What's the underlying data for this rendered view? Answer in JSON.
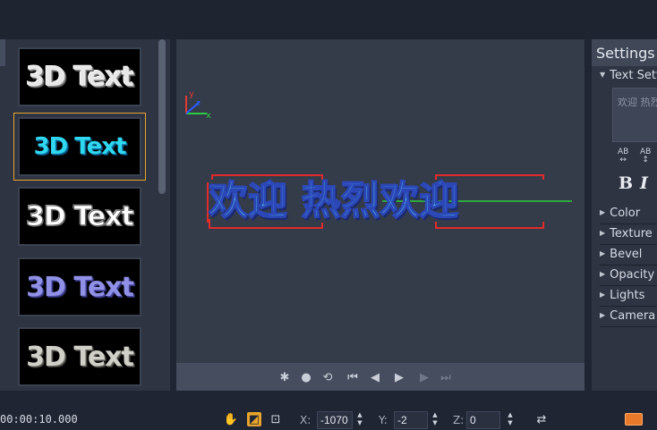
{
  "presets": [
    {
      "label": "3D Text",
      "selected": false
    },
    {
      "label": "3D Text",
      "selected": true
    },
    {
      "label": "3D Text",
      "selected": false
    },
    {
      "label": "3D Text",
      "selected": false
    },
    {
      "label": "3D Text",
      "selected": false
    }
  ],
  "canvas": {
    "text": "欢迎 热烈欢迎",
    "axis": {
      "x": "x",
      "y": "y",
      "z": "z"
    },
    "colors": {
      "background": "#343b49",
      "x_axis": "#2ecc40",
      "y_axis": "#e53935",
      "z_axis": "#2c5cff",
      "bbox": "#e02b2b"
    }
  },
  "playback": {
    "icons": [
      "bug-icon",
      "egg-icon",
      "loop-icon",
      "skip-start-icon",
      "step-back-icon",
      "play-icon",
      "step-forward-icon",
      "skip-end-icon"
    ]
  },
  "settings": {
    "title": "Settings",
    "text_section": "Text Settings",
    "text_preview": "欢迎 热烈欢迎",
    "bold": "B",
    "italic": "I",
    "ab1": "AB",
    "ab2": "AB",
    "sections": [
      "Color",
      "Texture",
      "Bevel",
      "Opacity",
      "Lights",
      "Camera"
    ]
  },
  "bottom": {
    "timecode": "00:00:10.000",
    "x_label": "X:",
    "x_value": "-1070",
    "y_label": "Y:",
    "y_value": "-2",
    "z_label": "Z:",
    "z_value": "0",
    "accent": "#e8a42e"
  }
}
